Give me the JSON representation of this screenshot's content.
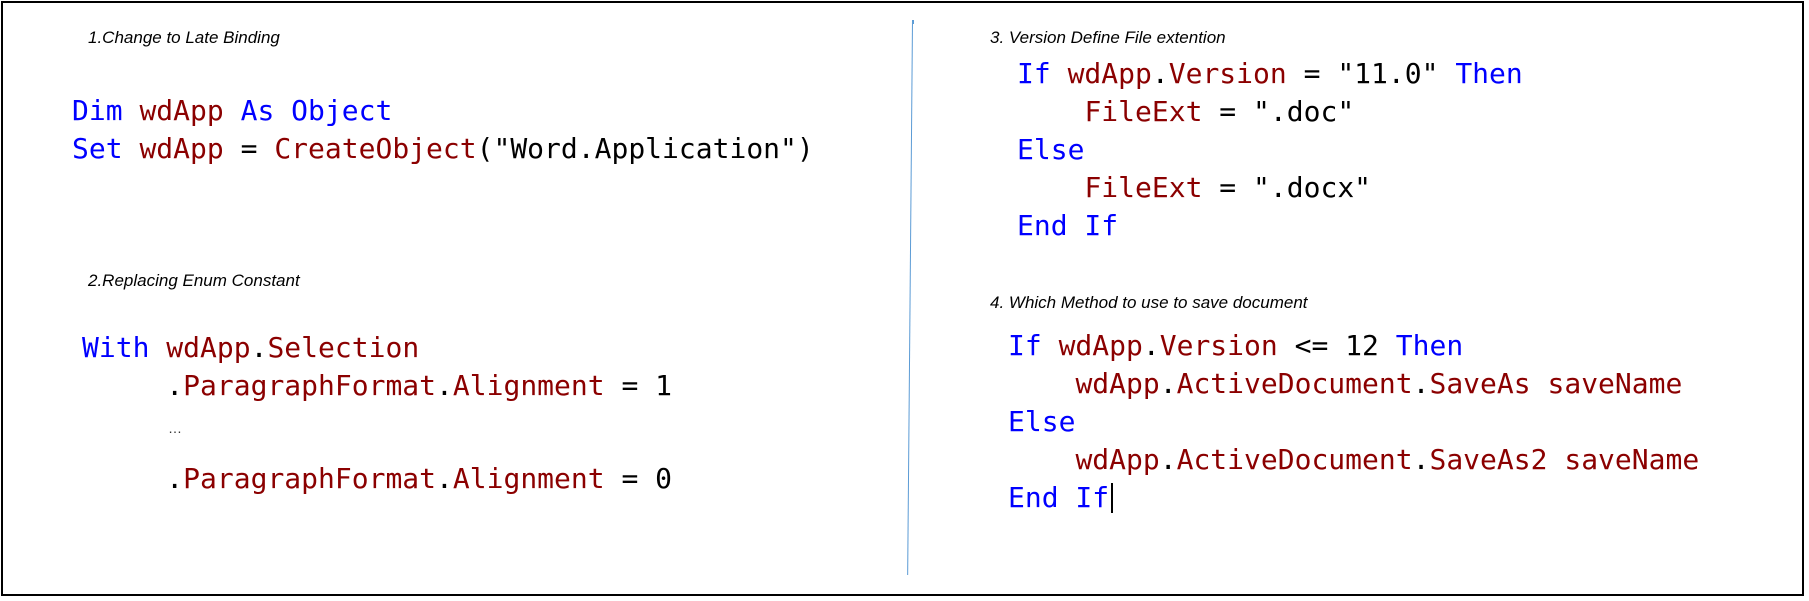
{
  "sections": {
    "s1": {
      "title": "1.Change to Late Binding",
      "lines": [
        [
          {
            "t": "Dim ",
            "c": "kw"
          },
          {
            "t": "wdApp",
            "c": "id"
          },
          {
            "t": " As ",
            "c": "kw"
          },
          {
            "t": "Object",
            "c": "kw"
          }
        ],
        [
          {
            "t": "Set ",
            "c": "kw"
          },
          {
            "t": "wdApp",
            "c": "id"
          },
          {
            "t": " = ",
            "c": "pl"
          },
          {
            "t": "CreateObject",
            "c": "id"
          },
          {
            "t": "(\"Word.Application\")",
            "c": "pl"
          }
        ]
      ]
    },
    "s2": {
      "title": "2.Replacing Enum Constant",
      "lines_top": [
        [
          {
            "t": "With ",
            "c": "kw"
          },
          {
            "t": "wdApp",
            "c": "id"
          },
          {
            "t": ".",
            "c": "pl"
          },
          {
            "t": "Selection",
            "c": "id"
          }
        ],
        [
          {
            "t": "     .",
            "c": "pl"
          },
          {
            "t": "ParagraphFormat",
            "c": "id"
          },
          {
            "t": ".",
            "c": "pl"
          },
          {
            "t": "Alignment",
            "c": "id"
          },
          {
            "t": " = 1",
            "c": "pl"
          }
        ]
      ],
      "ellipsis": "…",
      "lines_bottom": [
        [
          {
            "t": "     .",
            "c": "pl"
          },
          {
            "t": "ParagraphFormat",
            "c": "id"
          },
          {
            "t": ".",
            "c": "pl"
          },
          {
            "t": "Alignment",
            "c": "id"
          },
          {
            "t": " = 0",
            "c": "pl"
          }
        ]
      ]
    },
    "s3": {
      "title": "3. Version Define File extention",
      "lines": [
        [
          {
            "t": "If ",
            "c": "kw"
          },
          {
            "t": "wdApp",
            "c": "id"
          },
          {
            "t": ".",
            "c": "pl"
          },
          {
            "t": "Version",
            "c": "id"
          },
          {
            "t": " = \"11.0\" ",
            "c": "pl"
          },
          {
            "t": "Then",
            "c": "kw"
          }
        ],
        [
          {
            "t": "    ",
            "c": "pl"
          },
          {
            "t": "FileExt",
            "c": "id"
          },
          {
            "t": " = \".doc\"",
            "c": "pl"
          }
        ],
        [
          {
            "t": "Else",
            "c": "kw"
          }
        ],
        [
          {
            "t": "    ",
            "c": "pl"
          },
          {
            "t": "FileExt",
            "c": "id"
          },
          {
            "t": " = \".docx\"",
            "c": "pl"
          }
        ],
        [
          {
            "t": "End If",
            "c": "kw"
          }
        ]
      ]
    },
    "s4": {
      "title": "4. Which Method to use to save document",
      "lines": [
        [
          {
            "t": "If ",
            "c": "kw"
          },
          {
            "t": "wdApp",
            "c": "id"
          },
          {
            "t": ".",
            "c": "pl"
          },
          {
            "t": "Version",
            "c": "id"
          },
          {
            "t": " <= 12 ",
            "c": "pl"
          },
          {
            "t": "Then",
            "c": "kw"
          }
        ],
        [
          {
            "t": "    ",
            "c": "pl"
          },
          {
            "t": "wdApp",
            "c": "id"
          },
          {
            "t": ".",
            "c": "pl"
          },
          {
            "t": "ActiveDocument",
            "c": "id"
          },
          {
            "t": ".",
            "c": "pl"
          },
          {
            "t": "SaveAs",
            "c": "id"
          },
          {
            "t": " ",
            "c": "pl"
          },
          {
            "t": "saveName",
            "c": "id"
          }
        ],
        [
          {
            "t": "Else",
            "c": "kw"
          }
        ],
        [
          {
            "t": "    ",
            "c": "pl"
          },
          {
            "t": "wdApp",
            "c": "id"
          },
          {
            "t": ".",
            "c": "pl"
          },
          {
            "t": "ActiveDocument",
            "c": "id"
          },
          {
            "t": ".",
            "c": "pl"
          },
          {
            "t": "SaveAs2",
            "c": "id"
          },
          {
            "t": " ",
            "c": "pl"
          },
          {
            "t": "saveName",
            "c": "id"
          }
        ],
        [
          {
            "t": "End If",
            "c": "kw"
          }
        ]
      ]
    }
  },
  "colors": {
    "keyword": "#0000ff",
    "identifier": "#8b0000",
    "plain": "#000000",
    "divider": "#5b9bd5"
  }
}
